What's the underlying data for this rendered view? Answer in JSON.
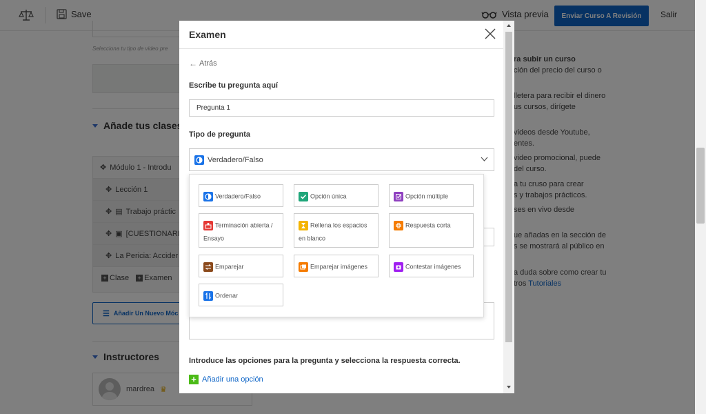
{
  "topbar": {
    "save_label": "Save",
    "preview_label": "Vista previa",
    "submit_label": "Enviar Curso A Revisión",
    "exit_label": "Salir"
  },
  "background": {
    "video_caption": "Selecciona tu tipo de video pre",
    "classes_title": "Añade tus clases",
    "modules": [
      {
        "label": "Módulo 1 - Introdu"
      },
      {
        "label": "Lección 1"
      },
      {
        "label": "Trabajo práctic"
      },
      {
        "label": "[CUESTIONARIO"
      },
      {
        "label": "La Pericia: Accider"
      }
    ],
    "add_class": "Clase",
    "add_exam": "Examen",
    "add_module": "Añadir Un Nuevo Móc",
    "instructors_title": "Instructores",
    "instructor_name": "mardrea",
    "right_lines": [
      "ra subir un curso",
      "ción del precio del curso o",
      "lletera para recibir el dinero",
      "us cursos, dirígete",
      "videos desde Youtube,",
      "entes.",
      "video promocional, puede",
      "del curso.",
      "a tu cruso para crear",
      "s y trabajos prácticos.",
      "ses en vivo desde",
      "ue añadas en la sección de",
      "s se mostrará al público en",
      "a duda sobre como crear tu",
      "tros "
    ],
    "right_link": "Tutoriales"
  },
  "modal": {
    "title": "Examen",
    "back_label": "Atrás",
    "question_label": "Escribe tu pregunta aquí",
    "question_value": "Pregunta 1",
    "type_label": "Tipo de pregunta",
    "selected_type": "Verdadero/Falso",
    "question_types": [
      {
        "label": "Verdadero/Falso",
        "icon": "true-false-icon",
        "color": "#1a73e8"
      },
      {
        "label": "Opción única",
        "icon": "single-choice-icon",
        "color": "#1fa67a"
      },
      {
        "label": "Opción múltiple",
        "icon": "multiple-choice-icon",
        "color": "#8e3fbf"
      },
      {
        "label": "Terminación abierta / Ensayo",
        "icon": "open-ended-icon",
        "color": "#e53935"
      },
      {
        "label": "Rellena los espacios en blanco",
        "icon": "fill-blanks-icon",
        "color": "#f4b400"
      },
      {
        "label": "Respuesta corta",
        "icon": "short-answer-icon",
        "color": "#f57c00"
      },
      {
        "label": "Emparejar",
        "icon": "matching-icon",
        "color": "#8b4a1c"
      },
      {
        "label": "Emparejar imágenes",
        "icon": "image-matching-icon",
        "color": "#f57c00"
      },
      {
        "label": "Contestar imágenes",
        "icon": "image-answering-icon",
        "color": "#a020f0"
      },
      {
        "label": "Ordenar",
        "icon": "ordering-icon",
        "color": "#1a73e8"
      }
    ],
    "options_label": "Introduce las opciones para la pregunta y selecciona la respuesta correcta.",
    "add_option_label": "Añadir una opción"
  },
  "colors": {
    "primary": "#0e65c7",
    "add_green": "#4cbb17"
  }
}
